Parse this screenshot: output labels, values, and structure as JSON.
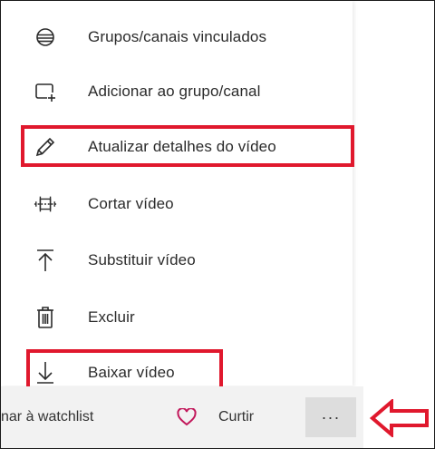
{
  "menu": {
    "items": [
      {
        "label": "Grupos/canais vinculados",
        "icon": "linked-groups-icon"
      },
      {
        "label": "Adicionar ao grupo/canal",
        "icon": "add-to-group-icon"
      },
      {
        "label": "Atualizar detalhes do vídeo",
        "icon": "pencil-icon"
      },
      {
        "label": "Cortar vídeo",
        "icon": "trim-icon"
      },
      {
        "label": "Substituir vídeo",
        "icon": "upload-icon"
      },
      {
        "label": "Excluir",
        "icon": "trash-icon"
      },
      {
        "label": "Baixar vídeo",
        "icon": "download-icon"
      }
    ]
  },
  "bottom_bar": {
    "watchlist_label": "nar à watchlist",
    "like_label": "Curtir",
    "more_label": "···"
  },
  "colors": {
    "highlight": "#e0182d",
    "bar_background": "#f2f2f2",
    "more_button_background": "#dddddd"
  }
}
